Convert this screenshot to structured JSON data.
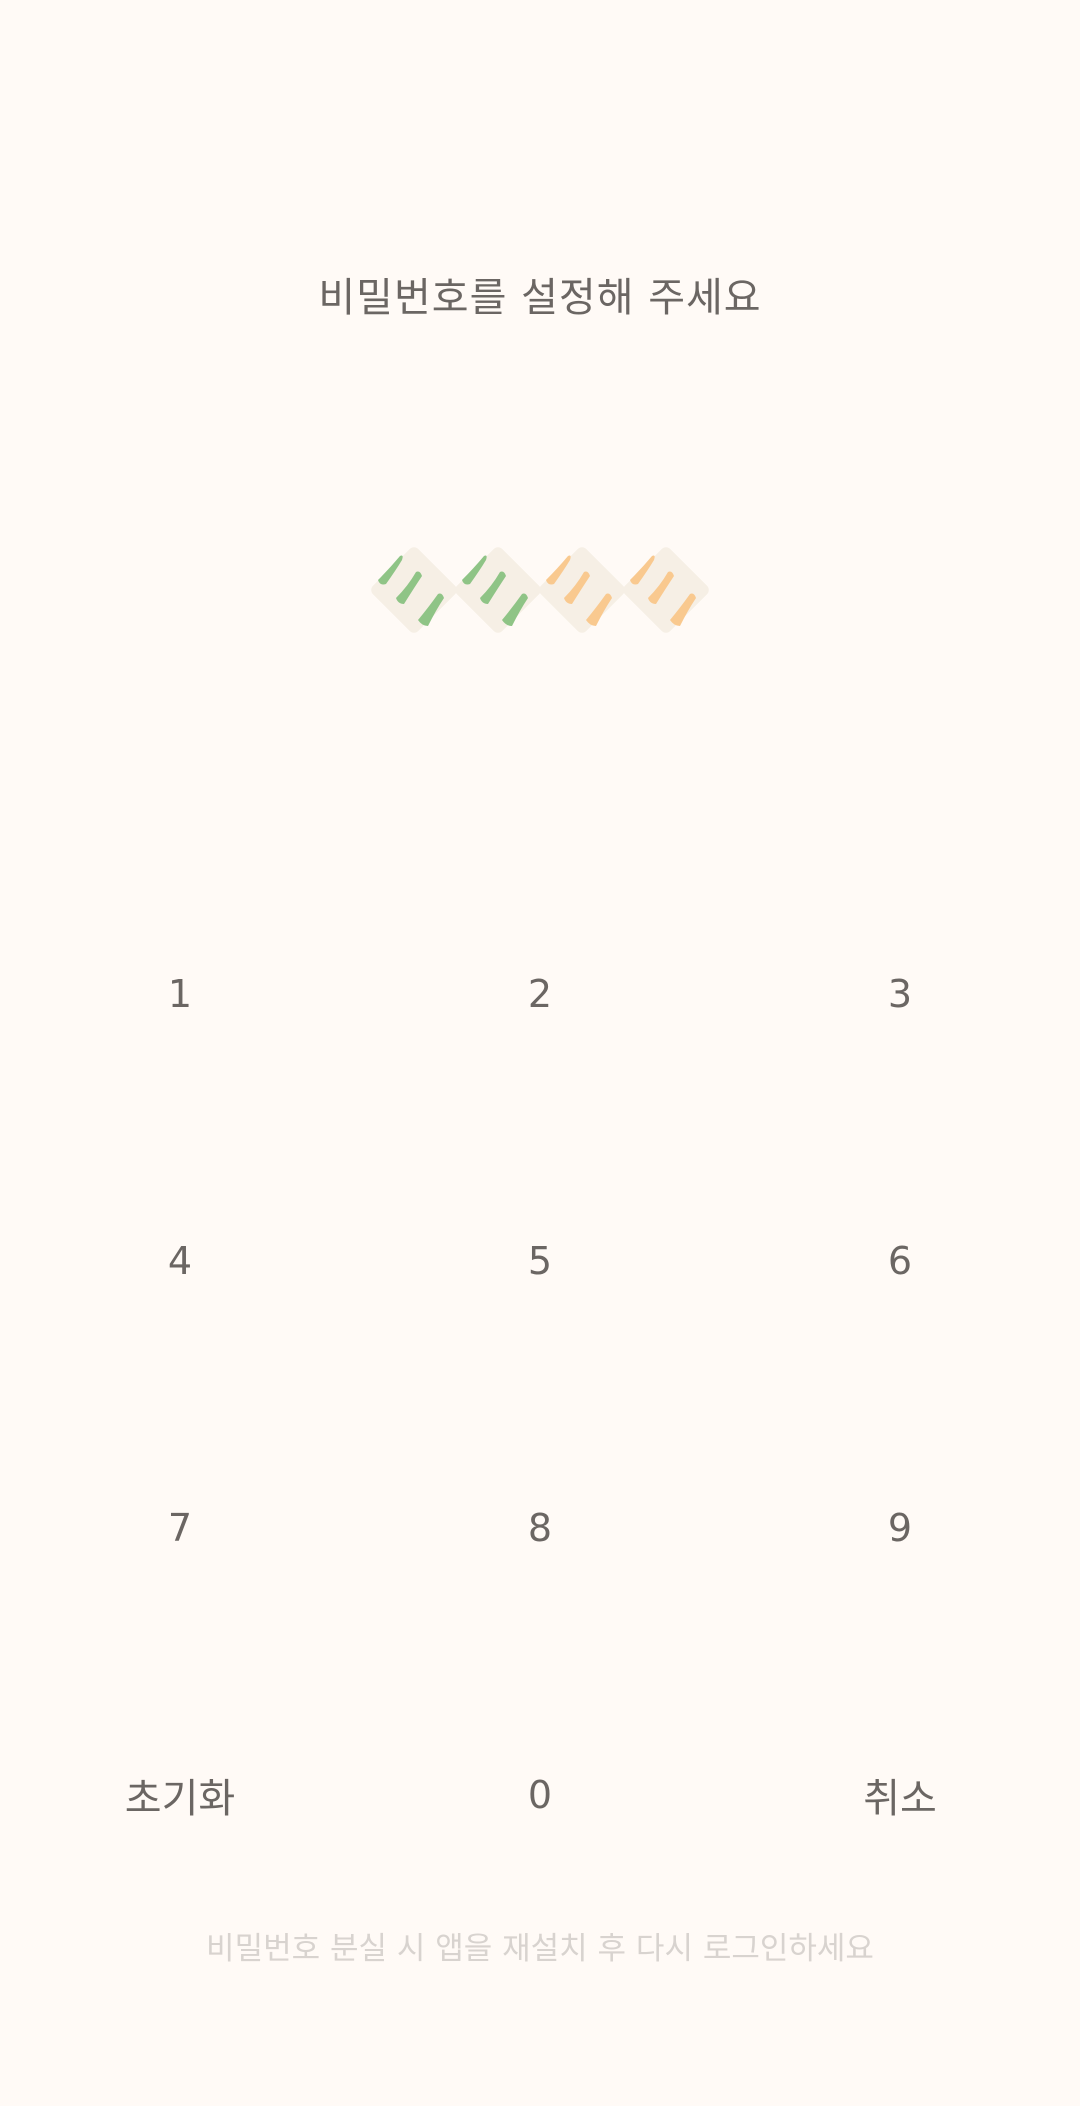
{
  "title": "비밀번호를 설정해 주세요",
  "pin_indicators": {
    "count": 4,
    "filled": 2,
    "filled_color": "#8fc486",
    "empty_color": "#f9c98f",
    "base_color": "#f6efe5"
  },
  "keypad": {
    "k1": "1",
    "k2": "2",
    "k3": "3",
    "k4": "4",
    "k5": "5",
    "k6": "6",
    "k7": "7",
    "k8": "8",
    "k9": "9",
    "reset": "초기화",
    "k0": "0",
    "cancel": "취소"
  },
  "footer_note": "비밀번호 분실 시 앱을 재설치 후 다시 로그인하세요"
}
